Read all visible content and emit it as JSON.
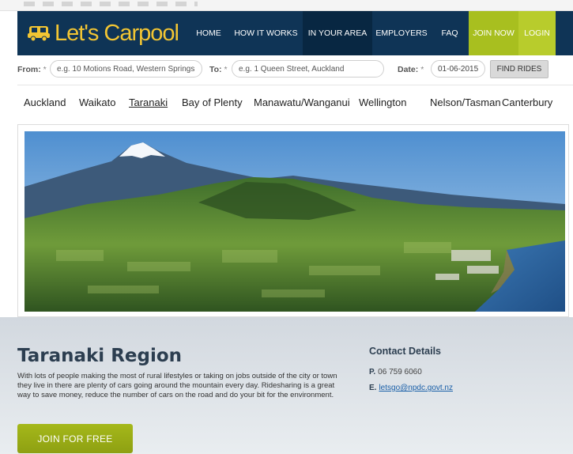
{
  "header": {
    "logo_text": "Let's Carpool",
    "nav": [
      {
        "label": "HOME"
      },
      {
        "label": "HOW IT WORKS"
      },
      {
        "label": "IN YOUR AREA"
      },
      {
        "label": "EMPLOYERS"
      },
      {
        "label": "FAQ"
      },
      {
        "label": "JOIN NOW"
      },
      {
        "label": "LOGIN"
      }
    ]
  },
  "search": {
    "from_label": "From:",
    "from_placeholder": "e.g. 10 Motions Road, Western Springs",
    "to_label": "To:",
    "to_placeholder": "e.g. 1 Queen Street, Auckland",
    "date_label": "Date:",
    "date_value": "01-06-2015",
    "required_mark": "*",
    "find_button": "FIND RIDES"
  },
  "regions": [
    {
      "label": "Auckland"
    },
    {
      "label": "Waikato"
    },
    {
      "label": "Taranaki"
    },
    {
      "label": "Bay of Plenty"
    },
    {
      "label": "Manawatu/Wanganui"
    },
    {
      "label": "Wellington"
    },
    {
      "label": "Nelson/Tasman"
    },
    {
      "label": "Canterbury"
    }
  ],
  "main": {
    "title": "Taranaki Region",
    "description": "With lots of people making the most of rural lifestyles or taking on jobs outside of the city or town they live in there are plenty of cars going around the mountain every day. Ridesharing is a great way to save money, reduce the number of cars on the road and do your bit for the environment.",
    "join_button": "JOIN FOR FREE"
  },
  "contact": {
    "title": "Contact Details",
    "phone_prefix": "P.",
    "phone": "06 759 6060",
    "email_prefix": "E.",
    "email": "letsgo@npdc.govt.nz"
  },
  "colors": {
    "header_bg": "#0f3456",
    "logo": "#f2c533",
    "accent_green": "#a8bf1f",
    "link": "#1a5fa8"
  }
}
